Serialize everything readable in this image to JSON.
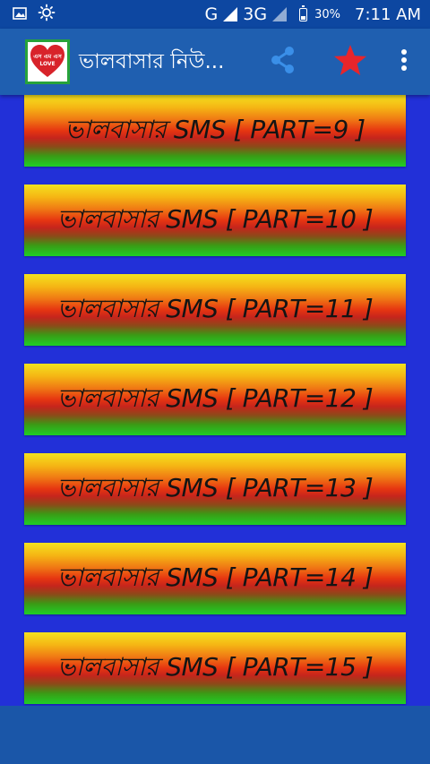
{
  "status_bar": {
    "network_label": "G",
    "network_type": "3G",
    "battery_percent": "30%",
    "time": "7:11 AM"
  },
  "app_bar": {
    "title": "ভালবাসার নিউ...",
    "logo_text_top": "এস এম এস",
    "logo_text_bottom": "LOVE"
  },
  "colors": {
    "status_bar": "#0d47a1",
    "app_bar": "#1f5fb0",
    "list_background": "#2230d8",
    "share_icon": "#3a8fe8",
    "star_icon": "#e8252b"
  },
  "icons": {
    "share": "share-icon",
    "favorite": "star-icon",
    "more": "more-vert-icon"
  },
  "items": [
    {
      "label": "ভালবাসার SMS [ PART=9 ]"
    },
    {
      "label": "ভালবাসার SMS [ PART=10 ]"
    },
    {
      "label": "ভালবাসার SMS [ PART=11 ]"
    },
    {
      "label": "ভালবাসার SMS [ PART=12 ]"
    },
    {
      "label": "ভালবাসার SMS [ PART=13 ]"
    },
    {
      "label": "ভালবাসার SMS [ PART=14 ]"
    },
    {
      "label": "ভালবাসার SMS [ PART=15 ]"
    }
  ]
}
